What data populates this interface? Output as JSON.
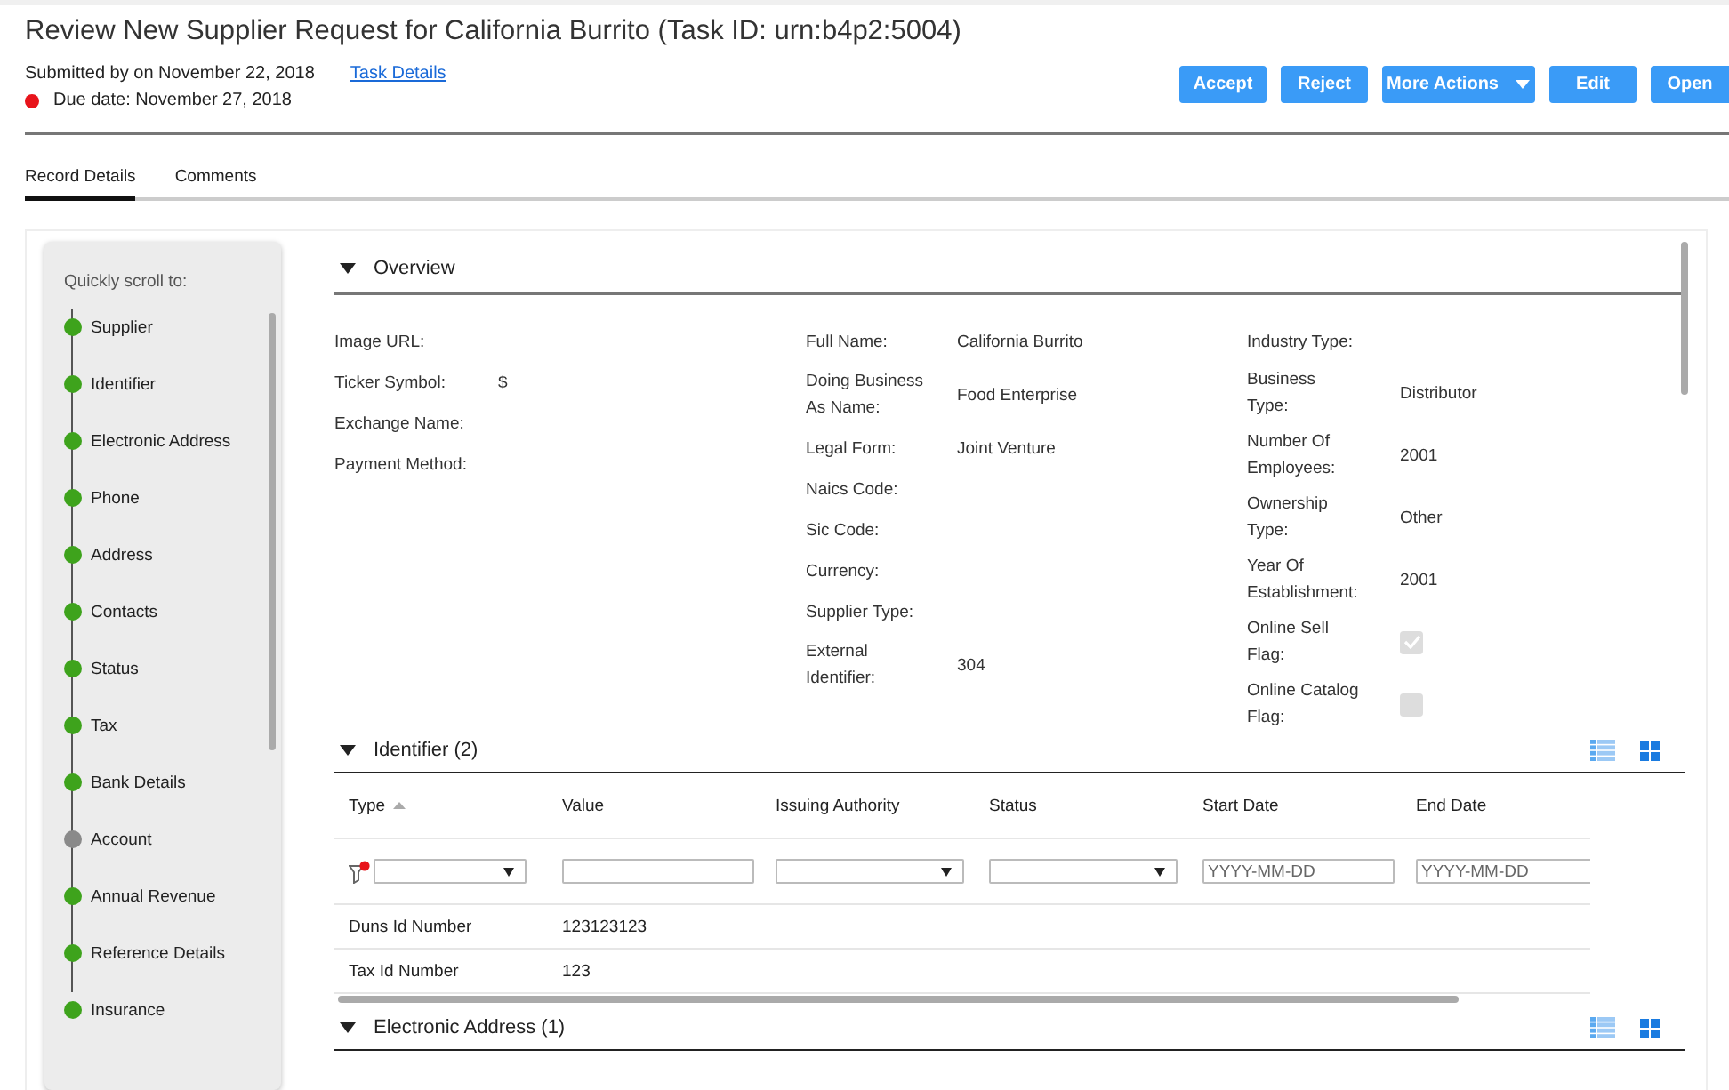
{
  "header": {
    "title": "Review New Supplier Request for California Burrito (Task ID: urn:b4p2:5004)",
    "submitted": "Submitted by on November 22, 2018",
    "task_link": "Task Details",
    "due": "Due date: November 27, 2018",
    "overdue": true,
    "buttons": [
      {
        "label": "Accept",
        "kind": "plain"
      },
      {
        "label": "Reject",
        "kind": "plain"
      },
      {
        "label": "More Actions",
        "kind": "menu"
      },
      {
        "label": "Edit",
        "kind": "plain"
      },
      {
        "label": "Open",
        "kind": "plain"
      }
    ]
  },
  "tabs": [
    {
      "label": "Record Details",
      "selected": true
    },
    {
      "label": "Comments",
      "selected": false
    }
  ],
  "sidebar": {
    "title": "Quickly scroll to:",
    "items": [
      {
        "label": "Supplier",
        "color": "#3ea31c"
      },
      {
        "label": "Identifier",
        "color": "#3ea31c"
      },
      {
        "label": "Electronic Address",
        "color": "#3ea31c"
      },
      {
        "label": "Phone",
        "color": "#3ea31c"
      },
      {
        "label": "Address",
        "color": "#3ea31c"
      },
      {
        "label": "Contacts",
        "color": "#3ea31c"
      },
      {
        "label": "Status",
        "color": "#3ea31c"
      },
      {
        "label": "Tax",
        "color": "#3ea31c"
      },
      {
        "label": "Bank Details",
        "color": "#3ea31c"
      },
      {
        "label": "Account",
        "color": "#8a8a8a"
      },
      {
        "label": "Annual Revenue",
        "color": "#3ea31c"
      },
      {
        "label": "Reference Details",
        "color": "#3ea31c"
      },
      {
        "label": "Insurance",
        "color": "#3ea31c"
      }
    ]
  },
  "overview": {
    "title": "Overview",
    "expanded": true,
    "columns": [
      [
        {
          "label": "Image URL:"
        },
        {
          "label": "Ticker Symbol:",
          "value": "$"
        },
        {
          "label": "Exchange Name:"
        },
        {
          "label": "Payment Method:"
        }
      ],
      [
        {
          "label": "Full Name:",
          "value": "California Burrito"
        },
        {
          "label": "Doing Business As Name:",
          "value": "Food Enterprise"
        },
        {
          "label": "Legal Form:",
          "value": "Joint Venture"
        },
        {
          "label": "Naics Code:"
        },
        {
          "label": "Sic Code:"
        },
        {
          "label": "Currency:"
        },
        {
          "label": "Supplier Type:"
        },
        {
          "label": "External Identifier:",
          "value": "304"
        }
      ],
      [
        {
          "label": "Industry Type:"
        },
        {
          "label": "Business Type:",
          "value": "Distributor"
        },
        {
          "label": "Number Of Employees:",
          "value": "2001"
        },
        {
          "label": "Ownership Type:",
          "value": "Other"
        },
        {
          "label": "Year Of Establishment:",
          "value": "2001"
        },
        {
          "label": "Online Sell Flag:",
          "kind": "checkbox",
          "checked": true
        },
        {
          "label": "Online Catalog Flag:",
          "kind": "checkbox",
          "checked": false
        }
      ]
    ]
  },
  "identifier": {
    "title": "Identifier (2)",
    "expanded": true,
    "columns": [
      {
        "label": "Type",
        "sorted_ascending": true
      },
      {
        "label": "Value"
      },
      {
        "label": "Issuing Authority"
      },
      {
        "label": "Status"
      },
      {
        "label": "Start Date"
      },
      {
        "label": "End Date"
      }
    ],
    "filters": [
      {
        "kind": "select"
      },
      {
        "kind": "text"
      },
      {
        "kind": "select"
      },
      {
        "kind": "select"
      },
      {
        "kind": "date",
        "placeholder": "YYYY-MM-DD"
      },
      {
        "kind": "date",
        "placeholder": "YYYY-MM-DD"
      }
    ],
    "rows": [
      [
        "Duns Id Number",
        "123123123"
      ],
      [
        "Tax Id Number",
        "123"
      ]
    ]
  },
  "electronic_address": {
    "title": "Electronic Address (1)",
    "expanded": true
  }
}
